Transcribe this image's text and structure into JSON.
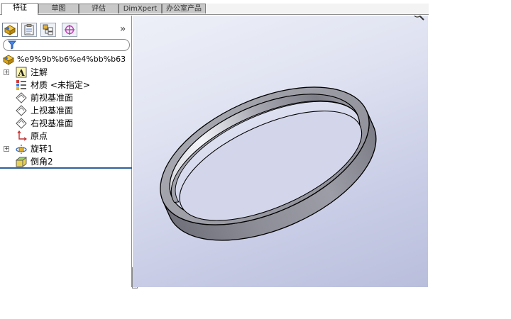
{
  "tabs": [
    {
      "label": "特征",
      "active": true
    },
    {
      "label": "草图",
      "active": false
    },
    {
      "label": "评估",
      "active": false
    },
    {
      "label": "DimXpert",
      "active": false
    },
    {
      "label": "办公室产品",
      "active": false
    }
  ],
  "panel": {
    "toolbar_icons": [
      "feature-manager-icon",
      "property-manager-icon",
      "configuration-manager-icon",
      "dimxpert-manager-icon"
    ],
    "expand_glyph": "»",
    "tree": {
      "root": "%e9%9b%b6%e4%bb%b63",
      "items": [
        {
          "label": "注解",
          "icon": "annotations-icon",
          "expandable": true
        },
        {
          "label": "材质 <未指定>",
          "icon": "material-icon",
          "expandable": false
        },
        {
          "label": "前视基准面",
          "icon": "plane-icon",
          "expandable": false
        },
        {
          "label": "上视基准面",
          "icon": "plane-icon",
          "expandable": false
        },
        {
          "label": "右视基准面",
          "icon": "plane-icon",
          "expandable": false
        },
        {
          "label": "原点",
          "icon": "origin-icon",
          "expandable": false
        },
        {
          "label": "旋转1",
          "icon": "revolve-icon",
          "expandable": true
        },
        {
          "label": "倒角2",
          "icon": "chamfer-icon",
          "expandable": false
        }
      ]
    }
  },
  "colors": {
    "model_face": "#9a9ba3",
    "model_edge": "#000000",
    "rollback_bar": "#2f5f9e",
    "viewport_top": "#eef0f8",
    "viewport_bottom": "#b9bedc"
  }
}
